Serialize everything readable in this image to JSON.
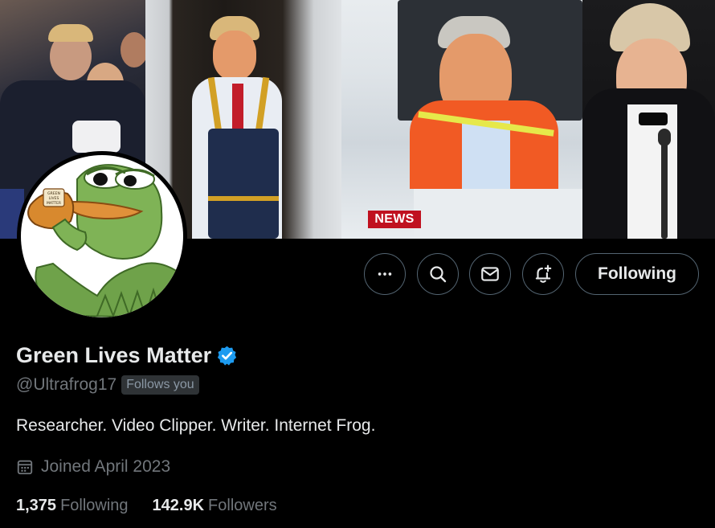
{
  "banner": {
    "news_tag": "NEWS"
  },
  "avatar": {
    "cup_text_line1": "GREEN",
    "cup_text_line2": "LIVES",
    "cup_text_line3": "MATTER"
  },
  "actions": {
    "more_icon": "more-horizontal-icon",
    "search_icon": "search-icon",
    "message_icon": "envelope-icon",
    "notify_icon": "bell-plus-icon",
    "following_label": "Following"
  },
  "profile": {
    "display_name": "Green Lives Matter",
    "verified_icon": "verified-badge-icon",
    "handle": "@Ultrafrog17",
    "follows_you": "Follows you",
    "bio": "Researcher. Video Clipper. Writer. Internet Frog.",
    "joined": "Joined April 2023",
    "following_count": "1,375",
    "following_label": "Following",
    "followers_count": "142.9K",
    "followers_label": "Followers"
  },
  "colors": {
    "background": "#000000",
    "text_primary": "#e7e9ea",
    "text_secondary": "#71767b",
    "border": "#536471",
    "verified_blue": "#1d9bf0"
  }
}
